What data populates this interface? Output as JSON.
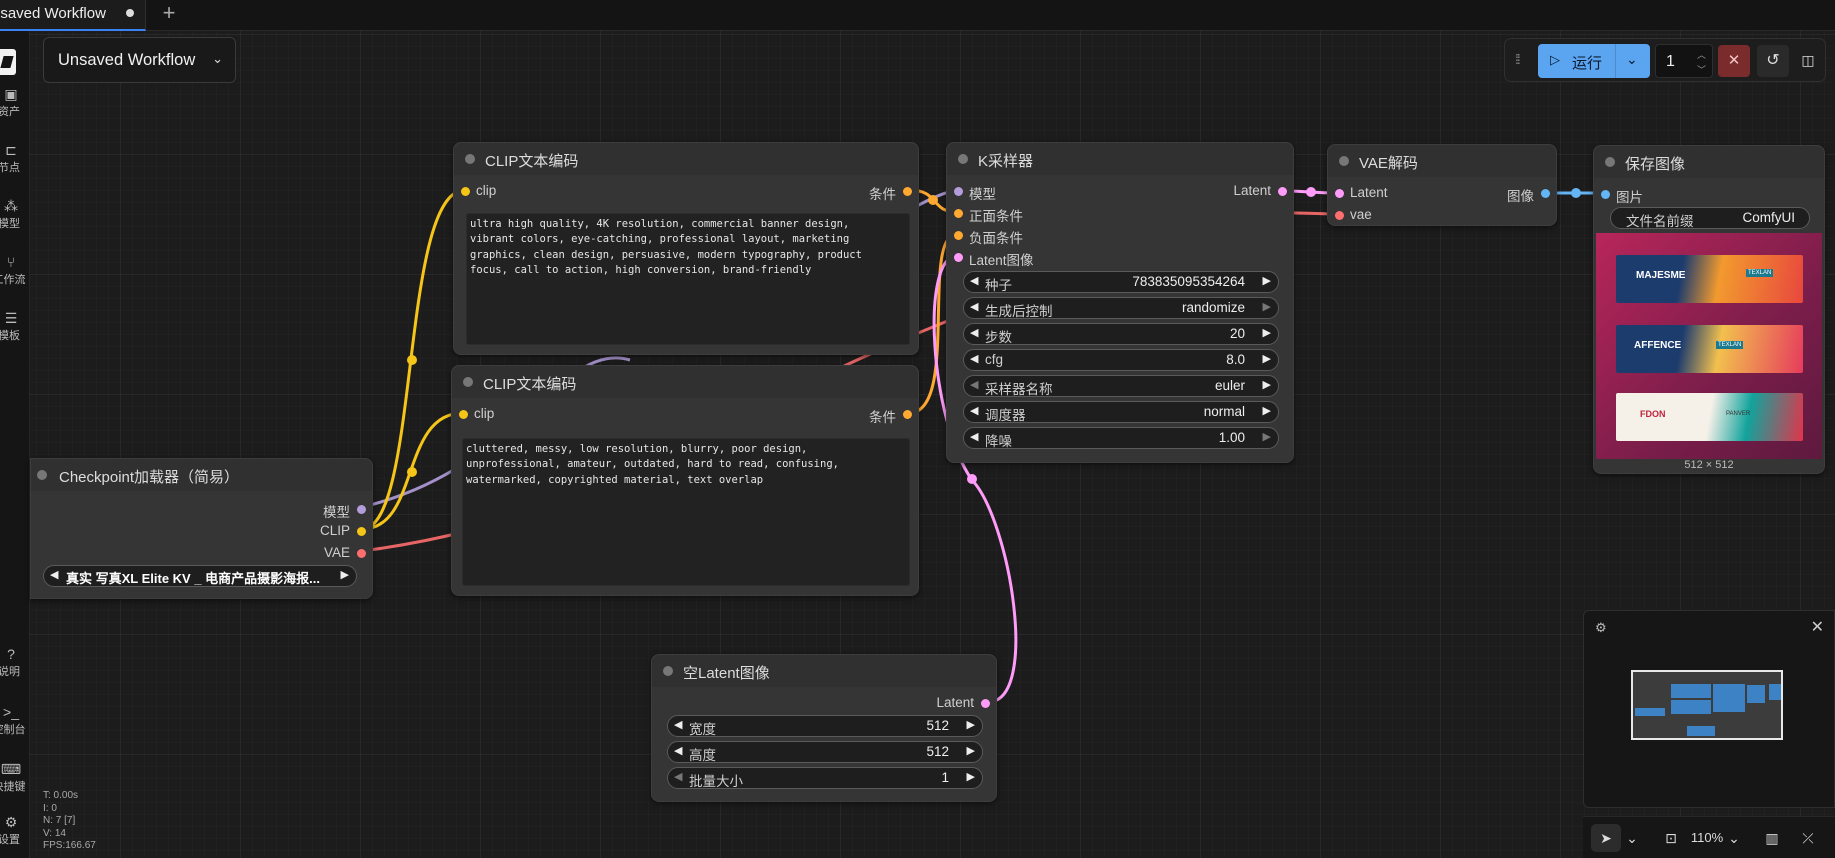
{
  "tabs": [
    {
      "label": "nsaved Workflow",
      "modified": true
    }
  ],
  "workflow": {
    "title": "Unsaved Workflow"
  },
  "sidebar": {
    "items": [
      {
        "label": "资产",
        "icon": "image-icon"
      },
      {
        "label": "节点",
        "icon": "node-icon"
      },
      {
        "label": "模型",
        "icon": "model-icon"
      },
      {
        "label": "工作流",
        "icon": "workflow-icon"
      },
      {
        "label": "模板",
        "icon": "template-icon"
      }
    ],
    "bottom_items": [
      {
        "label": "说明",
        "icon": "help-icon"
      },
      {
        "label": "控制台",
        "icon": "terminal-icon"
      },
      {
        "label": "快捷键",
        "icon": "keyboard-icon"
      },
      {
        "label": "设置",
        "icon": "gear-icon"
      }
    ]
  },
  "stats": {
    "t": "T: 0.00s",
    "i": "I: 0",
    "n": "N: 7 [7]",
    "v": "V: 14",
    "fps": "FPS:166.67"
  },
  "toolbar": {
    "run_label": "运行",
    "batch_count": "1"
  },
  "nodes": {
    "clip_pos": {
      "title": "CLIP文本编码",
      "input": "clip",
      "output": "条件",
      "text": "ultra high quality, 4K resolution, commercial banner design,\nvibrant colors, eye-catching, professional layout, marketing\ngraphics, clean design, persuasive, modern typography, product\nfocus, call to action, high conversion, brand-friendly"
    },
    "clip_neg": {
      "title": "CLIP文本编码",
      "input": "clip",
      "output": "条件",
      "text": "cluttered, messy, low resolution, blurry, poor design,\nunprofessional, amateur, outdated, hard to read, confusing,\nwatermarked, copyrighted material, text overlap"
    },
    "checkpoint": {
      "title": "Checkpoint加载器（简易）",
      "outputs": [
        "模型",
        "CLIP",
        "VAE"
      ],
      "ckpt_name": "真实 写真XL Elite KV _ 电商产品摄影海报..."
    },
    "ksampler": {
      "title": "K采样器",
      "inputs": [
        "模型",
        "正面条件",
        "负面条件",
        "Latent图像"
      ],
      "output": "Latent",
      "widgets": [
        {
          "label": "种子",
          "value": "783835095354264"
        },
        {
          "label": "生成后控制",
          "value": "randomize"
        },
        {
          "label": "步数",
          "value": "20"
        },
        {
          "label": "cfg",
          "value": "8.0"
        },
        {
          "label": "采样器名称",
          "value": "euler"
        },
        {
          "label": "调度器",
          "value": "normal"
        },
        {
          "label": "降噪",
          "value": "1.00"
        }
      ]
    },
    "vae_decode": {
      "title": "VAE解码",
      "inputs": [
        "Latent",
        "vae"
      ],
      "output": "图像"
    },
    "save_image": {
      "title": "保存图像",
      "input": "图片",
      "prefix_label": "文件名前缀",
      "prefix_value": "ComfyUI",
      "size_label": "512 × 512",
      "banners": [
        {
          "title": "MAJESME",
          "tag": "TEXLAN"
        },
        {
          "title": "AFFENCE",
          "tag": "TEXLAN"
        },
        {
          "title": "FDON",
          "tag": "PANVER"
        }
      ]
    },
    "empty_latent": {
      "title": "空Latent图像",
      "output": "Latent",
      "widgets": [
        {
          "label": "宽度",
          "value": "512"
        },
        {
          "label": "高度",
          "value": "512"
        },
        {
          "label": "批量大小",
          "value": "1"
        }
      ]
    }
  },
  "zoom": {
    "label": "110%"
  },
  "colors": {
    "accent": "#5ba4f0",
    "clip": "#f5c518",
    "model": "#b39ddb",
    "vae": "#ff6e6e",
    "latent": "#ff9cf9",
    "conditioning": "#ffa931",
    "image": "#64b5f6"
  }
}
